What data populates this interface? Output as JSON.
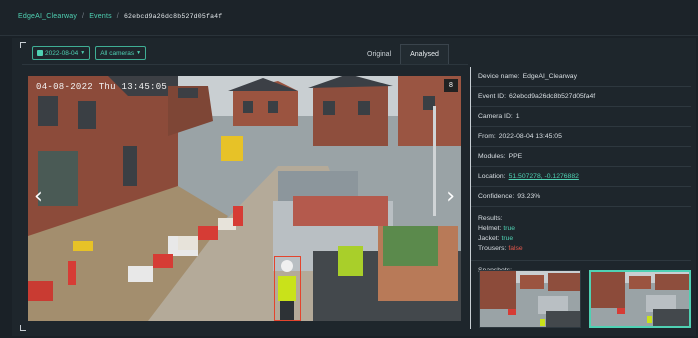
{
  "breadcrumb": {
    "root": "EdgeAI_Clearway",
    "sep1": "/",
    "section": "Events",
    "sep2": "/",
    "current": "62ebcd9a26dc8b527d05fa4f"
  },
  "filters": {
    "date": "2022-08-04",
    "camera": "All cameras"
  },
  "tabs": [
    {
      "label": "Original",
      "active": false
    },
    {
      "label": "Analysed",
      "active": true
    }
  ],
  "viewer": {
    "timestamp": "04-08-2022 Thu 13:45:05",
    "counter": "8",
    "prev_icon": "‹",
    "next_icon": "›"
  },
  "details": {
    "device_label": "Device name:",
    "device_value": "EdgeAI_Clearway",
    "event_label": "Event ID:",
    "event_value": "62ebcd9a26dc8b527d05fa4f",
    "camera_label": "Camera ID:",
    "camera_value": "1",
    "from_label": "From:",
    "from_value": "2022-08-04 13:45:05",
    "modules_label": "Modules:",
    "modules_value": "PPE",
    "location_label": "Location:",
    "location_value": "51.507278, -0.1276882",
    "confidence_label": "Confidence:",
    "confidence_value": "93.23%",
    "results_title": "Results:",
    "helmet_label": "Helmet:",
    "helmet_value": "true",
    "jacket_label": "Jacket:",
    "jacket_value": "true",
    "trousers_label": "Trousers:",
    "trousers_value": "false",
    "snapshots_title": "Snapshots:"
  },
  "colors": {
    "accent": "#4fd1b3",
    "false_value": "#e5574b",
    "bbox": "#e4442d",
    "background": "#1a2127"
  }
}
